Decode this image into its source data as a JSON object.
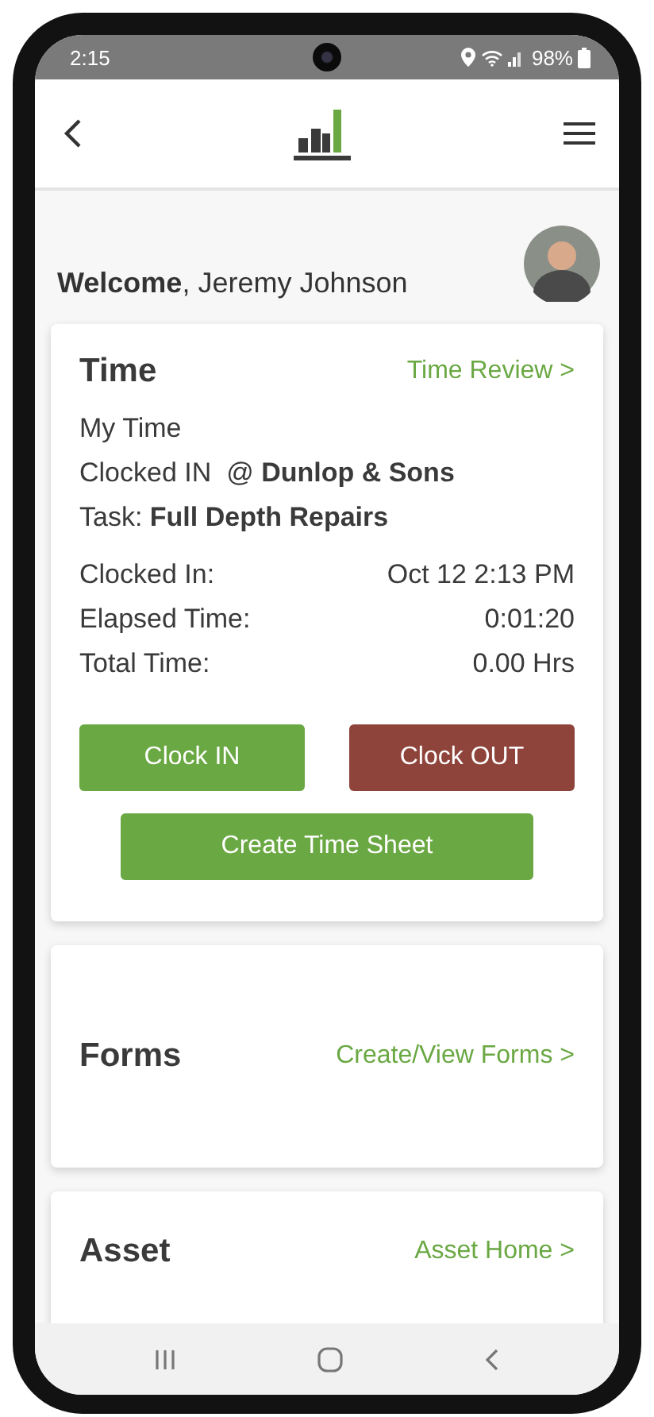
{
  "status_bar": {
    "time": "2:15",
    "battery": "98%"
  },
  "welcome": "**Welcome**, Jeremy Johnson",
  "time_card": {
    "title": "Time",
    "link": "Time Review >",
    "lines": [
      "My Time",
      "Clocked IN  @ **Dunlop & Sons**",
      "Task: **Full Depth Repairs**"
    ],
    "details": [
      {
        "label": "Clocked In:",
        "value": "Oct 12 2:13 PM"
      },
      {
        "label": "Elapsed Time:",
        "value": "0:01:20"
      },
      {
        "label": "Total Time:",
        "value": "0.00 Hrs"
      }
    ],
    "buttons": [
      {
        "label": "Clock IN",
        "kind": "go"
      },
      {
        "label": "Clock OUT",
        "kind": "stop"
      },
      {
        "label": "Create Time Sheet",
        "kind": "go"
      }
    ]
  },
  "sections": [
    {
      "title": "Forms",
      "link": "Create/View Forms >"
    },
    {
      "title": "Asset",
      "link": "Asset Home >"
    }
  ]
}
